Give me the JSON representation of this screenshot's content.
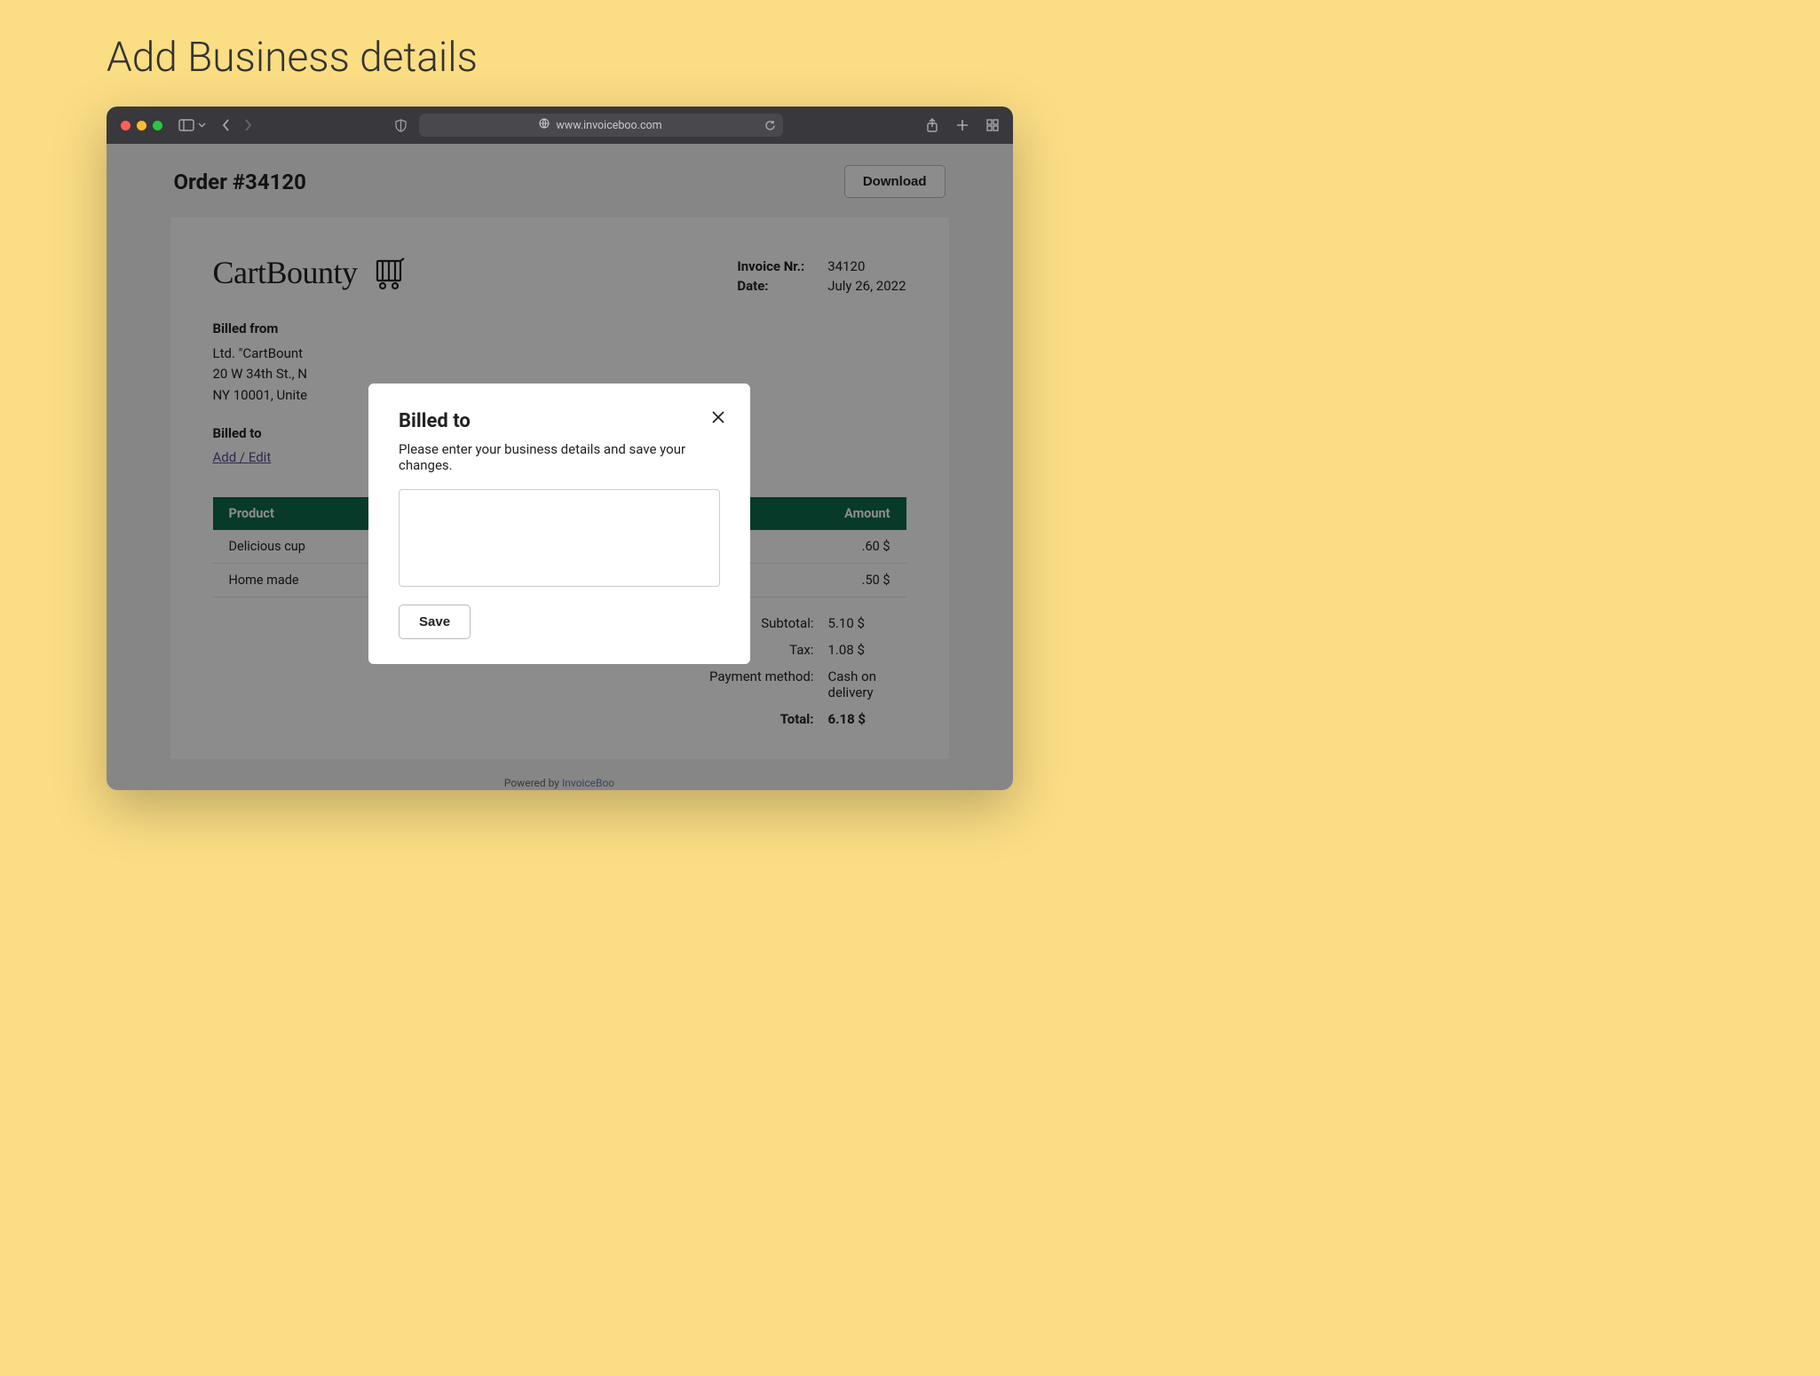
{
  "page": {
    "title": "Add Business details"
  },
  "browser": {
    "url": "www.invoiceboo.com"
  },
  "order": {
    "title": "Order #34120",
    "download": "Download"
  },
  "invoice": {
    "logo": "CartBounty",
    "meta": {
      "invoice_nr_label": "Invoice Nr.:",
      "invoice_nr": "34120",
      "date_label": "Date:",
      "date": "July 26, 2022"
    },
    "billed_from": {
      "heading": "Billed from",
      "line1": "Ltd. \"CartBount",
      "line2": "20 W 34th St., N",
      "line3": "NY 10001, Unite"
    },
    "billed_to": {
      "heading": "Billed to",
      "link": "Add / Edit"
    },
    "table": {
      "h_product": "Product",
      "h_amount": "Amount",
      "rows": [
        {
          "name": "Delicious cup",
          "amount": ".60 $"
        },
        {
          "name": "Home made",
          "amount": ".50 $"
        }
      ]
    },
    "totals": {
      "subtotal_label": "Subtotal:",
      "subtotal": "5.10 $",
      "tax_label": "Tax:",
      "tax": "1.08 $",
      "payment_label": "Payment method:",
      "payment": "Cash on delivery",
      "total_label": "Total:",
      "total": "6.18 $"
    },
    "powered_prefix": "Powered by ",
    "powered_link": "InvoiceBoo"
  },
  "modal": {
    "title": "Billed to",
    "desc": "Please enter your business details and save your changes.",
    "save": "Save"
  }
}
